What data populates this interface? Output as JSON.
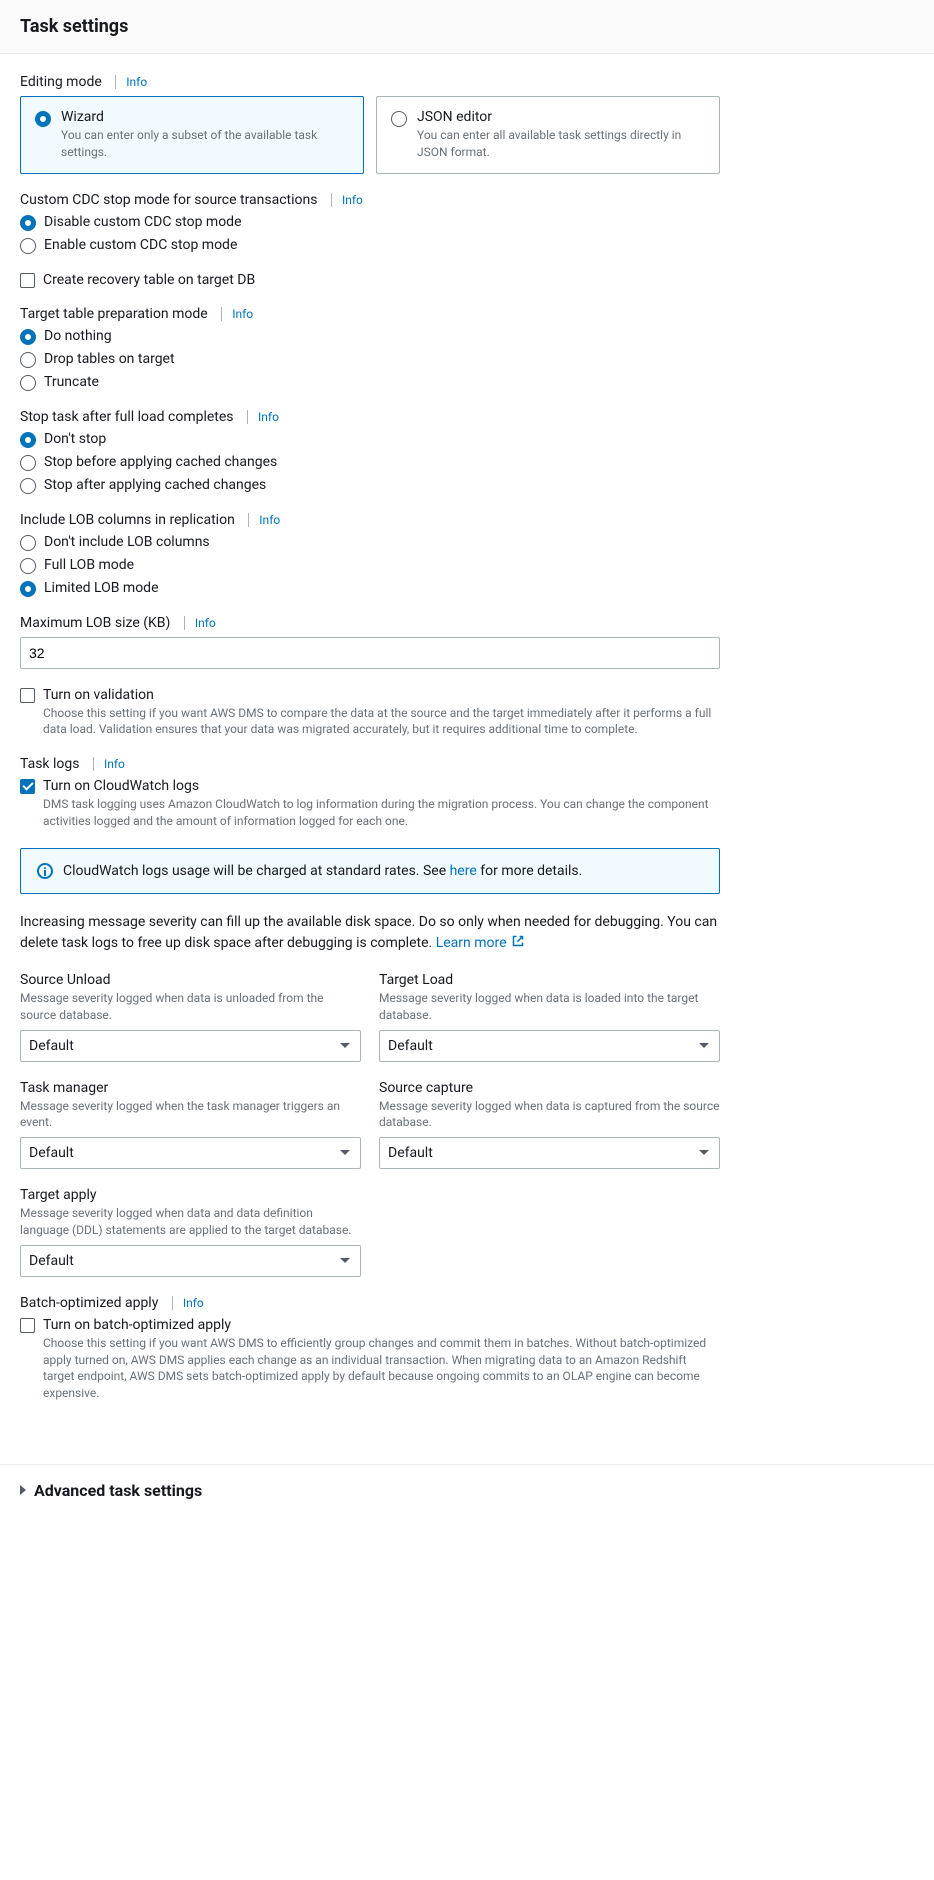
{
  "header": {
    "title": "Task settings"
  },
  "info_label": "Info",
  "editing_mode": {
    "label": "Editing mode",
    "wizard_title": "Wizard",
    "wizard_desc": "You can enter only a subset of the available task settings.",
    "json_title": "JSON editor",
    "json_desc": "You can enter all available task settings directly in JSON format."
  },
  "cdc_stop": {
    "label": "Custom CDC stop mode for source transactions",
    "opt_disable": "Disable custom CDC stop mode",
    "opt_enable": "Enable custom CDC stop mode"
  },
  "recovery_table": {
    "label": "Create recovery table on target DB"
  },
  "table_prep": {
    "label": "Target table preparation mode",
    "opt_nothing": "Do nothing",
    "opt_drop": "Drop tables on target",
    "opt_truncate": "Truncate"
  },
  "stop_task": {
    "label": "Stop task after full load completes",
    "opt_dont": "Don't stop",
    "opt_before": "Stop before applying cached changes",
    "opt_after": "Stop after applying cached changes"
  },
  "lob": {
    "label": "Include LOB columns in replication",
    "opt_none": "Don't include LOB columns",
    "opt_full": "Full LOB mode",
    "opt_limited": "Limited LOB mode"
  },
  "max_lob": {
    "label": "Maximum LOB size (KB)",
    "value": "32"
  },
  "validation": {
    "label": "Turn on validation",
    "desc": "Choose this setting if you want AWS DMS to compare the data at the source and the target immediately after it performs a full data load. Validation ensures that your data was migrated accurately, but it requires additional time to complete."
  },
  "task_logs": {
    "label": "Task logs",
    "cw_label": "Turn on CloudWatch logs",
    "cw_desc": "DMS task logging uses Amazon CloudWatch to log information during the migration process. You can change the component activities logged and the amount of information logged for each one."
  },
  "cw_notice": {
    "pre": "CloudWatch logs usage will be charged at standard rates. See ",
    "link": "here",
    "post": " for more details."
  },
  "severity_note": {
    "pre": "Increasing message severity can fill up the available disk space. Do so only when needed for debugging. You can delete task logs to free up disk space after debugging is complete. ",
    "link": "Learn more "
  },
  "log_selects": {
    "source_unload": {
      "label": "Source Unload",
      "desc": "Message severity logged when data is unloaded from the source database.",
      "value": "Default"
    },
    "target_load": {
      "label": "Target Load",
      "desc": "Message severity logged when data is loaded into the target database.",
      "value": "Default"
    },
    "task_manager": {
      "label": "Task manager",
      "desc": "Message severity logged when the task manager triggers an event.",
      "value": "Default"
    },
    "source_capture": {
      "label": "Source capture",
      "desc": "Message severity logged when data is captured from the source database.",
      "value": "Default"
    },
    "target_apply": {
      "label": "Target apply",
      "desc": "Message severity logged when data and data definition language (DDL) statements are applied to the target database.",
      "value": "Default"
    }
  },
  "batch_apply": {
    "label": "Batch-optimized apply",
    "opt_label": "Turn on batch-optimized apply",
    "desc": "Choose this setting if you want AWS DMS to efficiently group changes and commit them in batches. Without batch-optimized apply turned on, AWS DMS applies each change as an individual transaction. When migrating data to an Amazon Redshift target endpoint, AWS DMS sets batch-optimized apply by default because ongoing commits to an OLAP engine can become expensive."
  },
  "advanced": {
    "label": "Advanced task settings"
  }
}
